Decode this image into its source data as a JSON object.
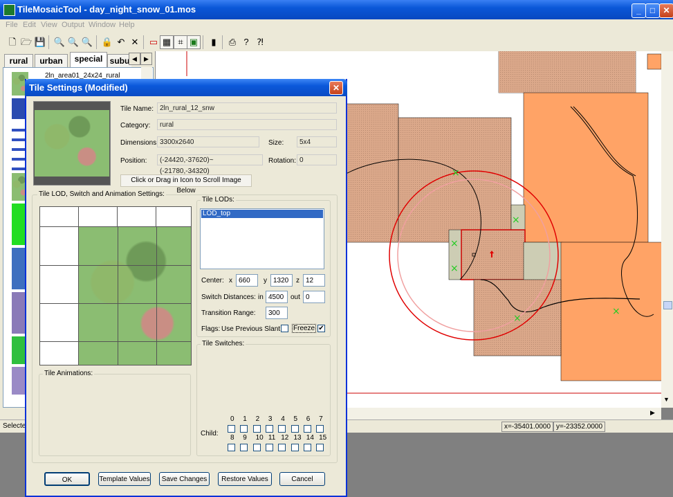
{
  "app": {
    "title": "TileMosaicTool - day_night_snow_01.mos",
    "window_controls": [
      "minimize-icon",
      "maximize-icon",
      "close-icon"
    ]
  },
  "menu": [
    "File",
    "Edit",
    "View",
    "Output",
    "Window",
    "Help"
  ],
  "left_tabs": [
    "rural",
    "urban",
    "special",
    "subu"
  ],
  "left_list_first_item": "2ln_area01_24x24_rural",
  "status": {
    "left": "Selecte",
    "x": "x=-35401.0000",
    "y": "y=-23352.0000"
  },
  "dialog": {
    "title": "Tile Settings (Modified)",
    "tile_name_label": "Tile Name:",
    "tile_name": "2ln_rural_12_snw",
    "category_label": "Category:",
    "category": "rural",
    "dimensions_label": "Dimensions:",
    "dimensions": "3300x2640",
    "size_label": "Size:",
    "size": "5x4",
    "position_label": "Position:",
    "position": "(-24420,-37620)~(-21780,-34320)",
    "rotation_label": "Rotation:",
    "rotation": "0",
    "scroll_hint": "Click or Drag in Icon to Scroll Image Below",
    "lod_group_label": "Tile LOD, Switch and Animation Settings:",
    "tile_lods_label": "Tile LODs:",
    "lod_items": [
      "LOD_top"
    ],
    "center_label": "Center:",
    "x_label": "x",
    "center_x": "660",
    "y_label": "y",
    "center_y": "1320",
    "z_label": "z",
    "center_z": "12",
    "switch_label": "Switch Distances:",
    "in_label": "in",
    "switch_in": "4500",
    "out_label": "out",
    "switch_out": "0",
    "transition_label": "Transition Range:",
    "transition": "300",
    "flags_label": "Flags:",
    "flag_slant_label": "Use Previous Slant",
    "flag_freeze_label": "Freeze",
    "flag_slant_checked": false,
    "flag_freeze_checked": true,
    "tile_switches_label": "Tile Switches:",
    "child_label": "Child:",
    "child_numbers_row1": [
      "0",
      "1",
      "2",
      "3",
      "4",
      "5",
      "6",
      "7"
    ],
    "child_numbers_row2": [
      "8",
      "9",
      "10",
      "11",
      "12",
      "13",
      "14",
      "15"
    ],
    "tile_animations_label": "Tile Animations:",
    "buttons": {
      "ok": "OK",
      "template": "Template Values",
      "save": "Save Changes",
      "restore": "Restore Values",
      "cancel": "Cancel"
    }
  },
  "colors": {
    "titlebar": "#0a57d8",
    "tile_orange": "#ffa366",
    "tile_tan": "#dba88a",
    "tile_gray": "#cdcdb4",
    "circle_red": "#e00000",
    "marker_green": "#22cc22"
  }
}
